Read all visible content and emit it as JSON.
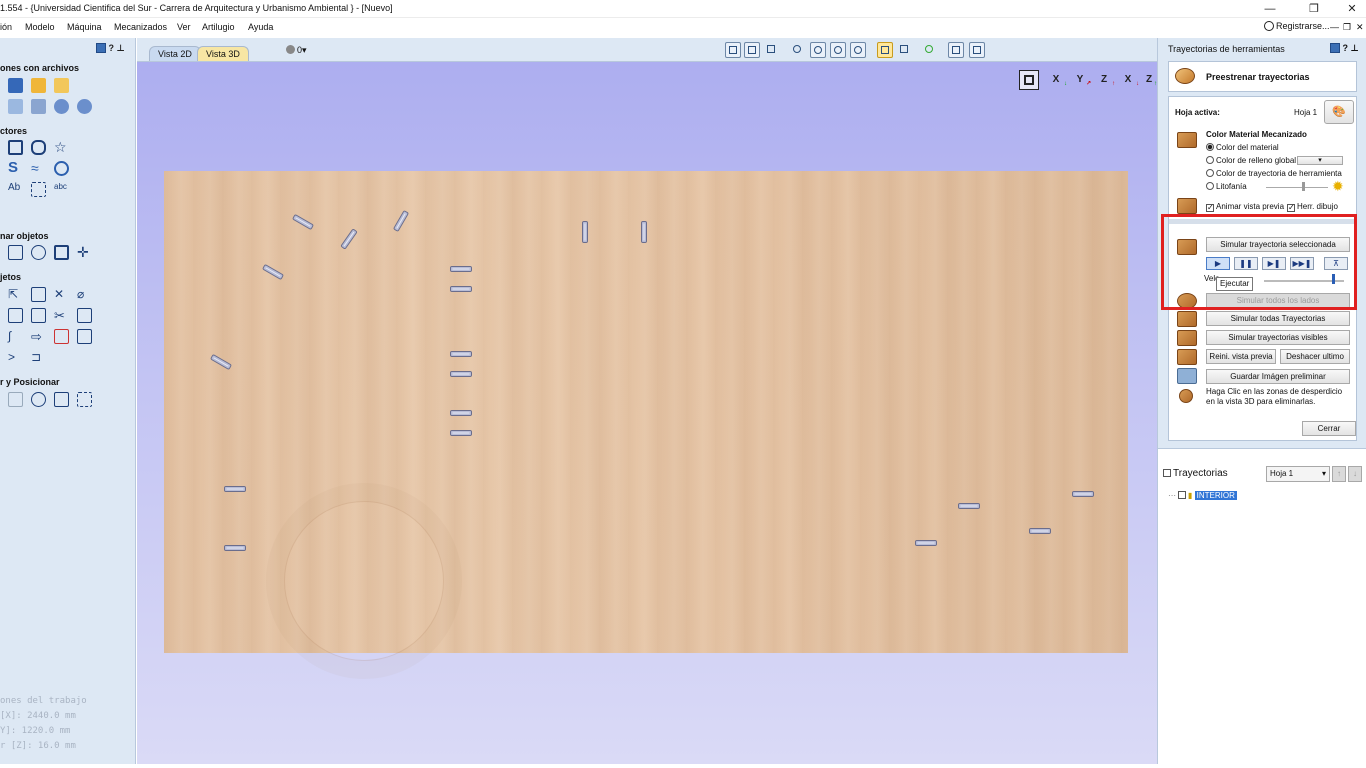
{
  "titlebar": {
    "title": "1.554 - {Universidad Cientifica del Sur - Carrera de Arquitectura y Urbanismo Ambiental } - [Nuevo]",
    "minimize": "—",
    "restore": "❐",
    "close": "✕"
  },
  "menubar": {
    "items": [
      "ión",
      "Modelo",
      "Máquina",
      "Mecanizados",
      "Ver",
      "Artilugio",
      "Ayuda"
    ],
    "register": "Registrarse...",
    "min": "—",
    "restore": "❐",
    "close": "✕"
  },
  "left_panel": {
    "help": "?",
    "sections": [
      "ones con archivos",
      "ctores",
      "nar objetos",
      "jetos",
      "r y Posicionar"
    ],
    "job_info": {
      "heading": "ones del trabajo",
      "x": "[X]: 2440.0 mm",
      "y": "Y]: 1220.0 mm",
      "z": "r [Z]: 16.0 mm"
    }
  },
  "view_tabs": {
    "tab_2d": "Vista 2D",
    "tab_3d": "Vista 3D",
    "layer": "0"
  },
  "viewport": {
    "axes": [
      "X",
      "Y",
      "Z",
      "X",
      "Z",
      "Y"
    ]
  },
  "right_panel": {
    "title": "Trayectorias de herramientas",
    "help": "?",
    "preview_button": "Preestrenar trayectorias",
    "active_sheet_label": "Hoja activa:",
    "active_sheet_value": "Hoja 1",
    "color_heading": "Color Material Mecanizado",
    "options": [
      "Color del material",
      "Color de relleno global",
      "Color de trayectoria de herramienta",
      "Litofanía"
    ],
    "selected_option": "Color del material",
    "animate_label": "Animar vista previa",
    "draw_tool_label": "Herr. dibujo",
    "simulate_selected": "Simular trayectoria seleccionada",
    "speed_label": "Velo",
    "tooltip": "Ejecutar",
    "simulate_all_sides": "Simular todos los lados",
    "simulate_all": "Simular todas Trayectorias",
    "simulate_visible": "Simular trayectorias visibles",
    "reset_preview": "Reini. vista previa",
    "undo_last": "Deshacer ultimo",
    "save_image": "Guardar Imágen preliminar",
    "hint": "Haga Clic en las zonas de desperdicio en la vista 3D para eliminarlas.",
    "close_button": "Cerrar",
    "toolpaths_heading": "Trayectorias",
    "sheet_select": "Hoja 1",
    "toolpath_item": "INTERIOR"
  }
}
